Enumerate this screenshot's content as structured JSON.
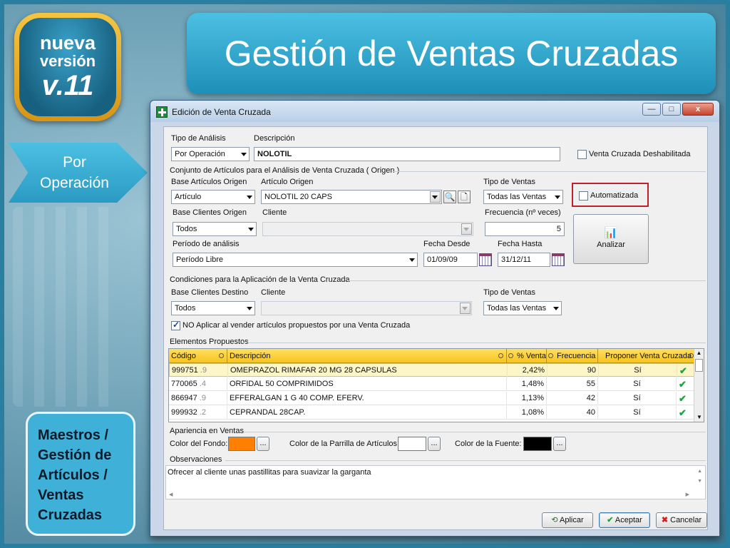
{
  "slide": {
    "logo": {
      "line1": "nueva",
      "line2": "versión",
      "line3": "v.11"
    },
    "title": "Gestión de Ventas Cruzadas",
    "arrow_label": "Por Operación",
    "path_label": "Maestros / Gestión de Artículos / Ventas Cruzadas"
  },
  "window": {
    "title": "Edición de Venta Cruzada",
    "controls": {
      "minimize": "—",
      "maximize": "□",
      "close": "x"
    }
  },
  "form": {
    "tipo_analisis_label": "Tipo de Análisis",
    "tipo_analisis_value": "Por Operación",
    "descripcion_label": "Descripción",
    "descripcion_value": "NOLOTIL",
    "deshabilitada_label": "Venta Cruzada Deshabilitada",
    "origen_group": "Conjunto de Artículos para el Análisis de Venta Cruzada ( Origen )",
    "base_articulos_label": "Base Artículos Origen",
    "base_articulos_value": "Artículo",
    "articulo_origen_label": "Artículo Origen",
    "articulo_origen_value": "NOLOTIL 20 CAPS",
    "tipo_ventas_label": "Tipo de Ventas",
    "tipo_ventas_value": "Todas las Ventas",
    "automatizada_label": "Automatizada",
    "base_clientes_label": "Base Clientes Origen",
    "base_clientes_value": "Todos",
    "cliente_label": "Cliente",
    "frecuencia_label": "Frecuencia (nº veces)",
    "frecuencia_value": "5",
    "analizar_label": "Analizar",
    "periodo_label": "Período de análisis",
    "periodo_value": "Período Libre",
    "fecha_desde_label": "Fecha Desde",
    "fecha_desde_value": "01/09/09",
    "fecha_hasta_label": "Fecha Hasta",
    "fecha_hasta_value": "31/12/11",
    "condiciones_group": "Condiciones para la Aplicación de la Venta Cruzada",
    "base_destino_label": "Base Clientes Destino",
    "base_destino_value": "Todos",
    "cliente2_label": "Cliente",
    "tipo_ventas2_label": "Tipo de Ventas",
    "tipo_ventas2_value": "Todas las Ventas",
    "no_aplicar_label": "NO Aplicar al vender artículos propuestos por una Venta Cruzada",
    "elementos_group": "Elementos Propuestos"
  },
  "table": {
    "headers": [
      "Código",
      "Descripción",
      "% Venta",
      "Frecuencia",
      "Proponer Venta Cruzada"
    ],
    "rows": [
      {
        "code": "999751",
        "suffix": ".9",
        "desc": "OMEPRAZOL RIMAFAR 20 MG 28 CAPSULAS",
        "pct": "2,42%",
        "freq": "90",
        "proponer": "Sí"
      },
      {
        "code": "770065",
        "suffix": ".4",
        "desc": "ORFIDAL 50 COMPRIMIDOS",
        "pct": "1,48%",
        "freq": "55",
        "proponer": "Sí"
      },
      {
        "code": "866947",
        "suffix": ".9",
        "desc": "EFFERALGAN 1 G 40 COMP. EFERV.",
        "pct": "1,13%",
        "freq": "42",
        "proponer": "Sí"
      },
      {
        "code": "999932",
        "suffix": ".2",
        "desc": "CEPRANDAL 28CAP.",
        "pct": "1,08%",
        "freq": "40",
        "proponer": "Sí"
      }
    ]
  },
  "apariencia": {
    "group": "Apariencia en Ventas",
    "fondo_label": "Color del Fondo:",
    "parrilla_label": "Color de la Parrilla de Artículos:",
    "fuente_label": "Color de la Fuente:",
    "fondo_color": "#ff8000",
    "parrilla_color": "#ffffff",
    "fuente_color": "#000000",
    "ellipsis": "..."
  },
  "observaciones": {
    "group": "Observaciones",
    "text": "Ofrecer al cliente unas pastillitas para suavizar la garganta"
  },
  "buttons": {
    "aplicar": "Aplicar",
    "aceptar": "Aceptar",
    "cancelar": "Cancelar"
  }
}
